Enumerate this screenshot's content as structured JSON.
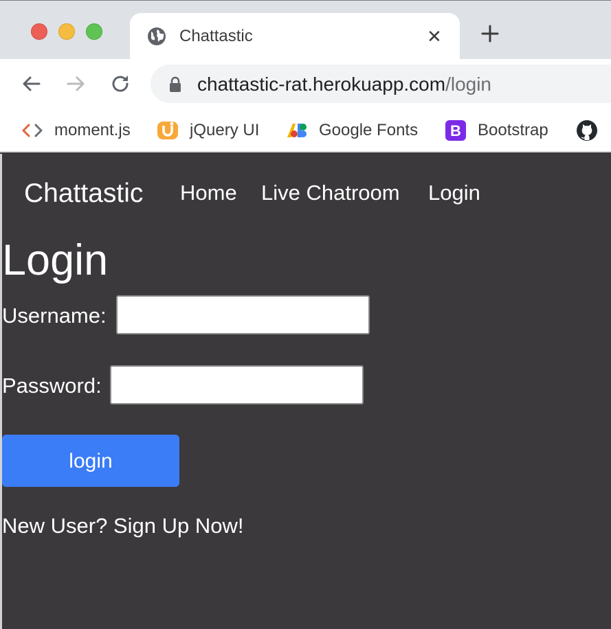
{
  "browser": {
    "tab": {
      "title": "Chattastic"
    },
    "url": {
      "host": "chattastic-rat.herokuapp.com",
      "path": "/login"
    },
    "bookmarks": [
      {
        "label": "moment.js",
        "icon": "code-brackets-icon"
      },
      {
        "label": "jQuery UI",
        "icon": "jquery-ui-icon"
      },
      {
        "label": "Google Fonts",
        "icon": "google-fonts-icon"
      },
      {
        "label": "Bootstrap",
        "icon": "bootstrap-icon"
      },
      {
        "label": "",
        "icon": "github-icon"
      }
    ]
  },
  "navbar": {
    "brand": "Chattastic",
    "links": [
      "Home",
      "Live Chatroom",
      "Login"
    ]
  },
  "page": {
    "heading": "Login",
    "username_label": "Username:",
    "username_value": "",
    "password_label": "Password:",
    "password_value": "",
    "login_button": "login",
    "signup_text": "New User? Sign Up Now!"
  },
  "colors": {
    "page_background": "#3b393b",
    "button": "#3b7cf7",
    "text": "#ffffff"
  }
}
